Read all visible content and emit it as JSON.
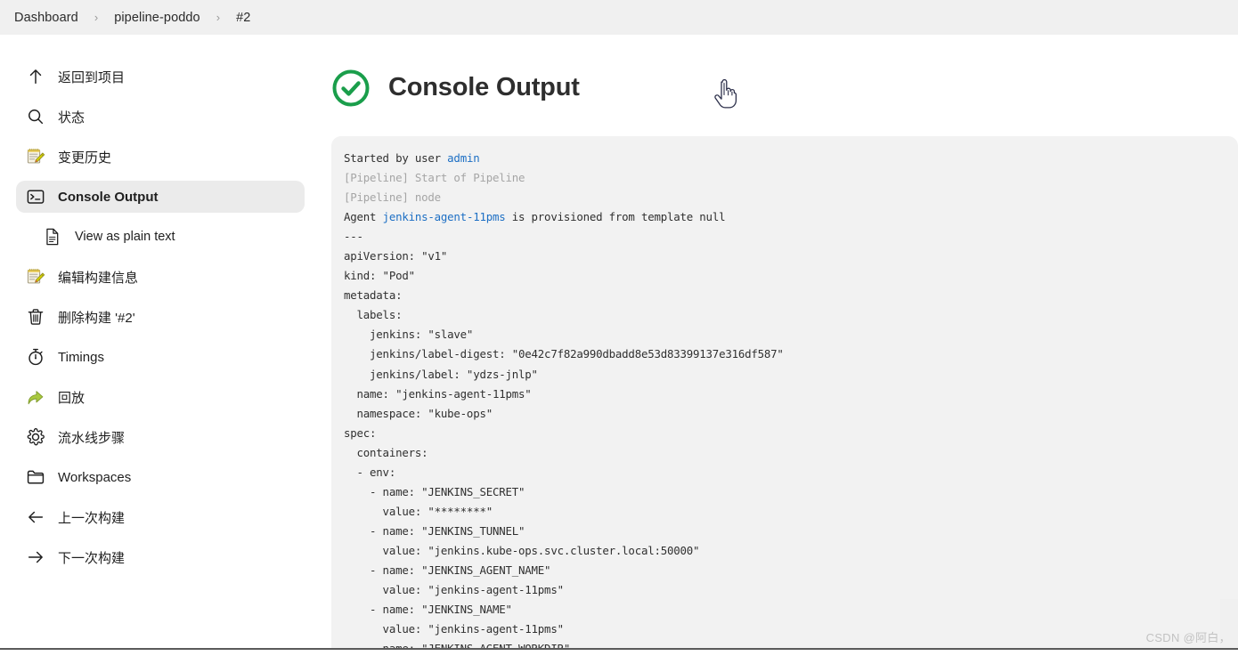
{
  "breadcrumb": {
    "items": [
      "Dashboard",
      "pipeline-poddo",
      "#2"
    ],
    "separator": "›"
  },
  "sidebar": {
    "items": [
      {
        "label": "返回到项目",
        "icon": "arrow-up-icon",
        "active": false,
        "sub": false
      },
      {
        "label": "状态",
        "icon": "search-icon",
        "active": false,
        "sub": false
      },
      {
        "label": "变更历史",
        "icon": "notepad-pencil-icon",
        "active": false,
        "sub": false
      },
      {
        "label": "Console Output",
        "icon": "terminal-icon",
        "active": true,
        "sub": false
      },
      {
        "label": "View as plain text",
        "icon": "document-icon",
        "active": false,
        "sub": true
      },
      {
        "label": "编辑构建信息",
        "icon": "notepad-pencil-icon",
        "active": false,
        "sub": false
      },
      {
        "label": "删除构建 '#2'",
        "icon": "trash-icon",
        "active": false,
        "sub": false
      },
      {
        "label": "Timings",
        "icon": "stopwatch-icon",
        "active": false,
        "sub": false
      },
      {
        "label": "回放",
        "icon": "replay-arrow-icon",
        "active": false,
        "sub": false
      },
      {
        "label": "流水线步骤",
        "icon": "gear-icon",
        "active": false,
        "sub": false
      },
      {
        "label": "Workspaces",
        "icon": "folder-icon",
        "active": false,
        "sub": false
      },
      {
        "label": "上一次构建",
        "icon": "arrow-left-icon",
        "active": false,
        "sub": false
      },
      {
        "label": "下一次构建",
        "icon": "arrow-right-icon",
        "active": false,
        "sub": false
      }
    ]
  },
  "main": {
    "title": "Console Output",
    "status": "success",
    "status_color": "#1a9e4b"
  },
  "console": {
    "lines": [
      {
        "segments": [
          {
            "t": "Started by user ",
            "k": "plain"
          },
          {
            "t": "admin",
            "k": "link"
          }
        ]
      },
      {
        "dim": true,
        "segments": [
          {
            "t": "[Pipeline] Start of Pipeline",
            "k": "plain"
          }
        ]
      },
      {
        "dim": true,
        "segments": [
          {
            "t": "[Pipeline] node",
            "k": "plain"
          }
        ]
      },
      {
        "segments": [
          {
            "t": "Agent ",
            "k": "plain"
          },
          {
            "t": "jenkins-agent-11pms",
            "k": "link"
          },
          {
            "t": " is provisioned from template null",
            "k": "plain"
          }
        ]
      },
      {
        "segments": [
          {
            "t": "---",
            "k": "plain"
          }
        ]
      },
      {
        "segments": [
          {
            "t": "apiVersion: \"v1\"",
            "k": "plain"
          }
        ]
      },
      {
        "segments": [
          {
            "t": "kind: \"Pod\"",
            "k": "plain"
          }
        ]
      },
      {
        "segments": [
          {
            "t": "metadata:",
            "k": "plain"
          }
        ]
      },
      {
        "segments": [
          {
            "t": "  labels:",
            "k": "plain"
          }
        ]
      },
      {
        "segments": [
          {
            "t": "    jenkins: \"slave\"",
            "k": "plain"
          }
        ]
      },
      {
        "segments": [
          {
            "t": "    jenkins/label-digest: \"0e42c7f82a990dbadd8e53d83399137e316df587\"",
            "k": "plain"
          }
        ]
      },
      {
        "segments": [
          {
            "t": "    jenkins/label: \"ydzs-jnlp\"",
            "k": "plain"
          }
        ]
      },
      {
        "segments": [
          {
            "t": "  name: \"jenkins-agent-11pms\"",
            "k": "plain"
          }
        ]
      },
      {
        "segments": [
          {
            "t": "  namespace: \"kube-ops\"",
            "k": "plain"
          }
        ]
      },
      {
        "segments": [
          {
            "t": "spec:",
            "k": "plain"
          }
        ]
      },
      {
        "segments": [
          {
            "t": "  containers:",
            "k": "plain"
          }
        ]
      },
      {
        "segments": [
          {
            "t": "  - env:",
            "k": "plain"
          }
        ]
      },
      {
        "segments": [
          {
            "t": "    - name: \"JENKINS_SECRET\"",
            "k": "plain"
          }
        ]
      },
      {
        "segments": [
          {
            "t": "      value: \"********\"",
            "k": "plain"
          }
        ]
      },
      {
        "segments": [
          {
            "t": "    - name: \"JENKINS_TUNNEL\"",
            "k": "plain"
          }
        ]
      },
      {
        "segments": [
          {
            "t": "      value: \"jenkins.kube-ops.svc.cluster.local:50000\"",
            "k": "plain"
          }
        ]
      },
      {
        "segments": [
          {
            "t": "    - name: \"JENKINS_AGENT_NAME\"",
            "k": "plain"
          }
        ]
      },
      {
        "segments": [
          {
            "t": "      value: \"jenkins-agent-11pms\"",
            "k": "plain"
          }
        ]
      },
      {
        "segments": [
          {
            "t": "    - name: \"JENKINS_NAME\"",
            "k": "plain"
          }
        ]
      },
      {
        "segments": [
          {
            "t": "      value: \"jenkins-agent-11pms\"",
            "k": "plain"
          }
        ]
      },
      {
        "segments": [
          {
            "t": "    - name: \"JENKINS_AGENT_WORKDIR\"",
            "k": "plain"
          }
        ]
      }
    ]
  },
  "watermark": {
    "text": "CSDN @阿白，"
  }
}
